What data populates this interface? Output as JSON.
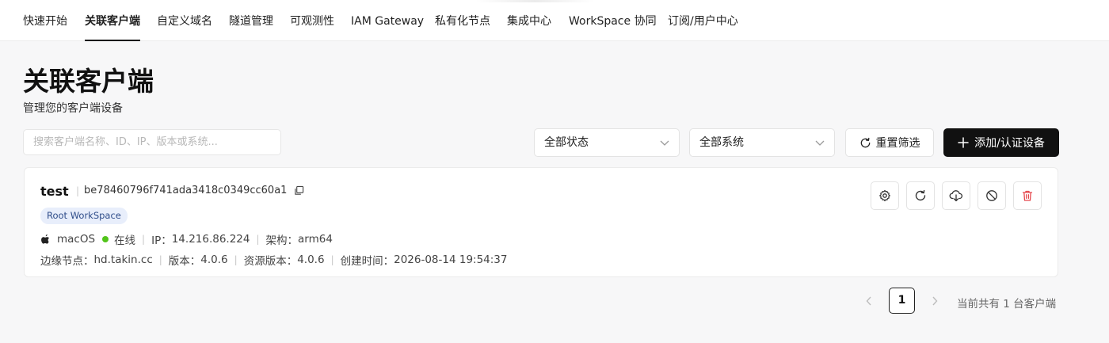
{
  "nav": {
    "tabs": [
      {
        "label": "快速开始"
      },
      {
        "label": "关联客户端"
      },
      {
        "label": "自定义域名"
      },
      {
        "label": "隧道管理"
      },
      {
        "label": "可观测性"
      },
      {
        "label": "IAM Gateway"
      },
      {
        "label": "私有化节点"
      },
      {
        "label": "集成中心"
      },
      {
        "label": "WorkSpace 协同"
      },
      {
        "label": "订阅/用户中心"
      }
    ],
    "active_tab": "关联客户端"
  },
  "page": {
    "title": "关联客户端",
    "subtitle": "管理您的客户端设备"
  },
  "filters": {
    "search_placeholder": "搜索客户端名称、ID、IP、版本或系统...",
    "status_select": "全部状态",
    "system_select": "全部系统",
    "reset_label": "重置筛选",
    "add_label": "添加/认证设备"
  },
  "device": {
    "name": "test",
    "id": "be78460796f741ada3418c0349cc60a1",
    "workspace_badge": "Root WorkSpace",
    "os": "macOS",
    "status": "在线",
    "status_color": "#52c41a",
    "ip_label": "IP：",
    "ip": "14.216.86.224",
    "arch_label": "架构：",
    "arch": "arm64",
    "edge_label": "边缘节点：",
    "edge": "hd.takin.cc",
    "version_label": "版本：",
    "version": "4.0.6",
    "res_version_label": "资源版本：",
    "res_version": "4.0.6",
    "created_label": "创建时间：",
    "created": "2026-08-14 19:54:37",
    "actions": [
      "gear-icon",
      "refresh-icon",
      "download-cloud-icon",
      "ban-icon",
      "trash-icon"
    ]
  },
  "pagination": {
    "current": "1",
    "total_text": "当前共有 1 台客户端"
  },
  "colors": {
    "accent": "#111111",
    "danger": "#e5484d",
    "badge_bg": "#e8eefb"
  }
}
